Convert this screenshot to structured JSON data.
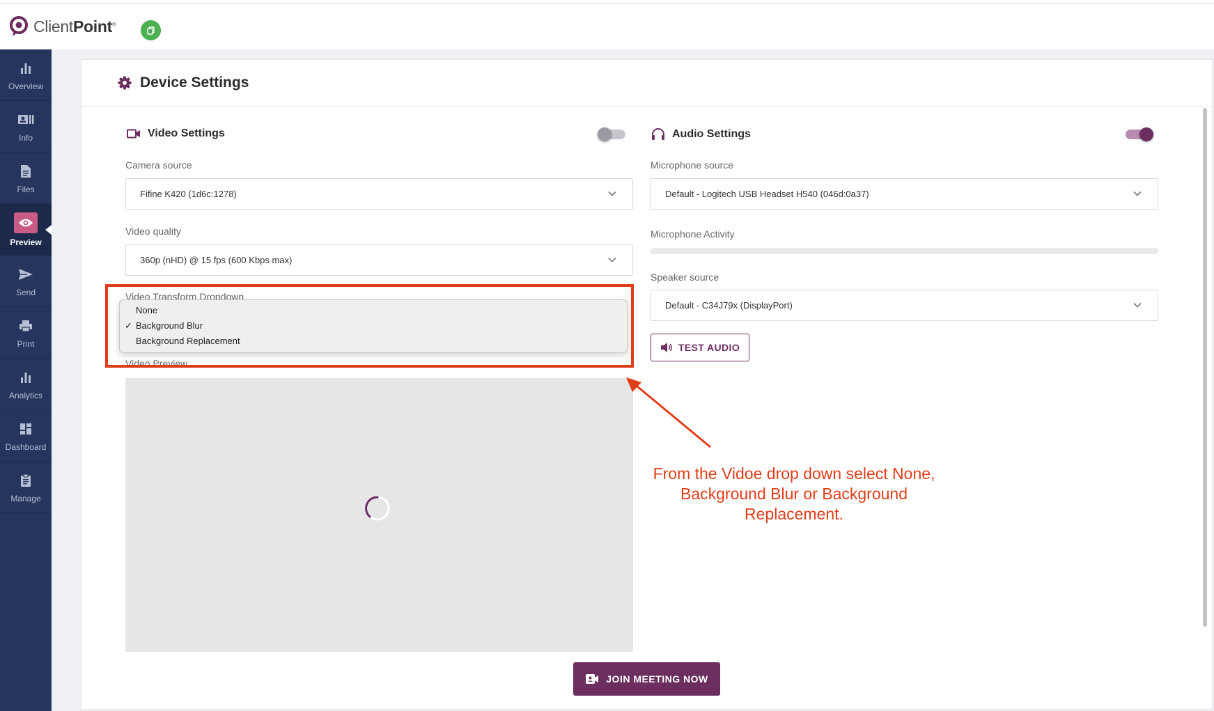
{
  "brand": {
    "name_light": "Client",
    "name_bold": "Point",
    "trademark": "®"
  },
  "sidebar": {
    "items": [
      {
        "label": "Overview",
        "icon": "bar-chart-icon"
      },
      {
        "label": "Info",
        "icon": "id-card-icon"
      },
      {
        "label": "Files",
        "icon": "file-icon"
      },
      {
        "label": "Preview",
        "icon": "eye-icon",
        "active": true
      },
      {
        "label": "Send",
        "icon": "send-icon"
      },
      {
        "label": "Print",
        "icon": "printer-icon"
      },
      {
        "label": "Analytics",
        "icon": "bar-chart-icon"
      },
      {
        "label": "Dashboard",
        "icon": "dashboard-icon"
      },
      {
        "label": "Manage",
        "icon": "clipboard-icon"
      }
    ]
  },
  "page": {
    "title": "Device Settings"
  },
  "video": {
    "title": "Video Settings",
    "enabled": false,
    "camera_label": "Camera source",
    "camera_value": "Fifine K420 (1d6c:1278)",
    "quality_label": "Video quality",
    "quality_value": "360p (nHD) @ 15 fps (600 Kbps max)",
    "transform_label": "Video Transform Dropdown",
    "transform_options": [
      "None",
      "Background Blur",
      "Background Replacement"
    ],
    "transform_selected": "Background Blur",
    "preview_label": "Video Preview"
  },
  "audio": {
    "title": "Audio Settings",
    "enabled": true,
    "mic_label": "Microphone source",
    "mic_value": "Default - Logitech USB Headset H540 (046d:0a37)",
    "activity_label": "Microphone Activity",
    "activity_level": 0,
    "speaker_label": "Speaker source",
    "speaker_value": "Default - C34J79x (DisplayPort)",
    "test_button": "TEST AUDIO"
  },
  "join_button": "JOIN MEETING NOW",
  "annotation": "From the Vidoe drop down select None, Background Blur or Background Replacement.",
  "colors": {
    "primary": "#6b2e5f",
    "sidebar": "#25355e",
    "annotation": "#e03e1a",
    "green": "#4caf50",
    "active_icon_bg": "#c85c86"
  }
}
